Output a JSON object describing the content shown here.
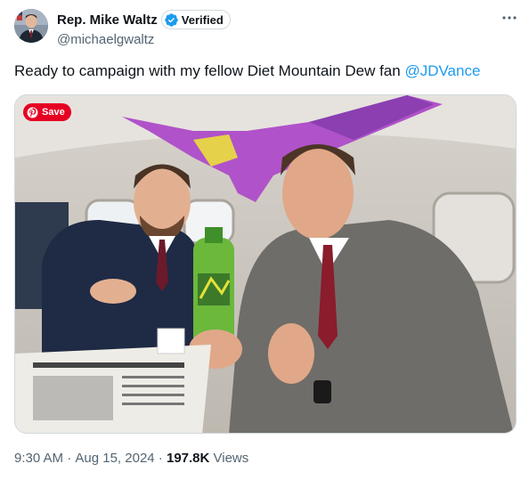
{
  "author": {
    "display_name": "Rep. Mike Waltz",
    "verified_label": "Verified",
    "handle": "@michaelgwaltz",
    "avatar_icon": "profile-photo"
  },
  "more_icon": "more-dots-icon",
  "tweet": {
    "text": "Ready to campaign with my fellow Diet Mountain Dew fan ",
    "mention": "@JDVance"
  },
  "photo": {
    "save_label": "Save",
    "save_icon": "pinterest-icon"
  },
  "meta": {
    "time": "9:30 AM",
    "separator": " · ",
    "date": "Aug 15, 2024",
    "views_count": "197.8K",
    "views_label": " Views"
  },
  "colors": {
    "link": "#1d9bf0",
    "verified_badge": "#1d9bf0",
    "pinterest": "#e60023",
    "secondary_text": "#536471"
  }
}
